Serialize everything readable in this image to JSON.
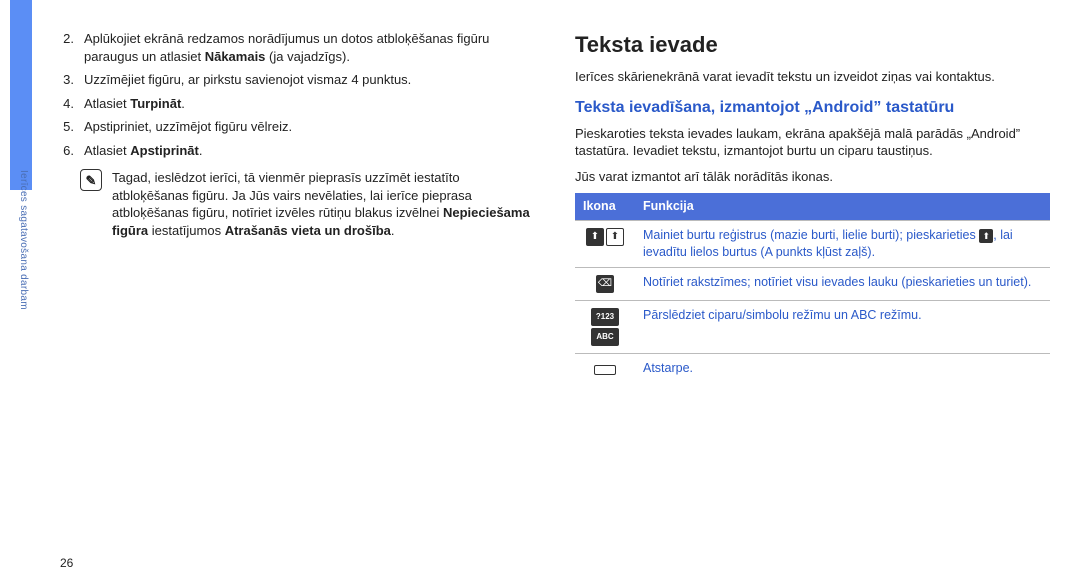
{
  "sidebar": {
    "label": "Ierīces sagatavošana darbam"
  },
  "page_number": "26",
  "left": {
    "steps": [
      {
        "num": "2.",
        "pre": "Aplūkojiet ekrānā redzamos norādījumus un dotos atbloķēšanas figūru paraugus un atlasiet ",
        "bold": "Nākamais",
        "post": " (ja vajadzīgs)."
      },
      {
        "num": "3.",
        "pre": "Uzzīmējiet figūru, ar pirkstu savienojot vismaz 4 punktus.",
        "bold": "",
        "post": ""
      },
      {
        "num": "4.",
        "pre": "Atlasiet ",
        "bold": "Turpināt",
        "post": "."
      },
      {
        "num": "5.",
        "pre": "Apstipriniet, uzzīmējot figūru vēlreiz.",
        "bold": "",
        "post": ""
      },
      {
        "num": "6.",
        "pre": "Atlasiet ",
        "bold": "Apstiprināt",
        "post": "."
      }
    ],
    "note": {
      "text_a": "Tagad, ieslēdzot ierīci, tā vienmēr pieprasīs uzzīmēt iestatīto atbloķēšanas figūru. Ja Jūs vairs nevēlaties, lai ierīce pieprasa atbloķēšanas figūru, notīriet izvēles rūtiņu blakus izvēlnei ",
      "bold_a": "Nepieciešama figūra",
      "text_b": " iestatījumos ",
      "bold_b": "Atrašanās vieta un drošība",
      "text_c": "."
    }
  },
  "right": {
    "heading": "Teksta ievade",
    "intro": "Ierīces skārienekrānā varat ievadīt tekstu un izveidot ziņas vai kontaktus.",
    "subheading": "Teksta ievadīšana, izmantojot „Android” tastatūru",
    "para1": "Pieskaroties teksta ievades laukam, ekrāna apakšējā malā parādās „Android” tastatūra. Ievadiet tekstu, izmantojot burtu un ciparu taustiņus.",
    "para2": "Jūs varat izmantot arī tālāk norādītās ikonas.",
    "table": {
      "head_icon": "Ikona",
      "head_func": "Funkcija",
      "rows": [
        {
          "icons": [
            "shift-solid",
            "shift-outline"
          ],
          "text_a": "Mainiet burtu reģistrus (mazie burti, lielie burti); pieskarieties ",
          "inline_icon": "shift-inline",
          "text_b": ", lai ievadītu lielos burtus (A punkts kļūst zaļš)."
        },
        {
          "icons": [
            "backspace"
          ],
          "text_a": "Notīriet rakstzīmes; notīriet visu ievades lauku (pieskarieties un turiet).",
          "inline_icon": "",
          "text_b": ""
        },
        {
          "icons": [
            "mode-123",
            "mode-abc"
          ],
          "text_a": "Pārslēdziet ciparu/simbolu režīmu un ABC režīmu.",
          "inline_icon": "",
          "text_b": ""
        },
        {
          "icons": [
            "space"
          ],
          "text_a": "Atstarpe.",
          "inline_icon": "",
          "text_b": ""
        }
      ]
    }
  }
}
